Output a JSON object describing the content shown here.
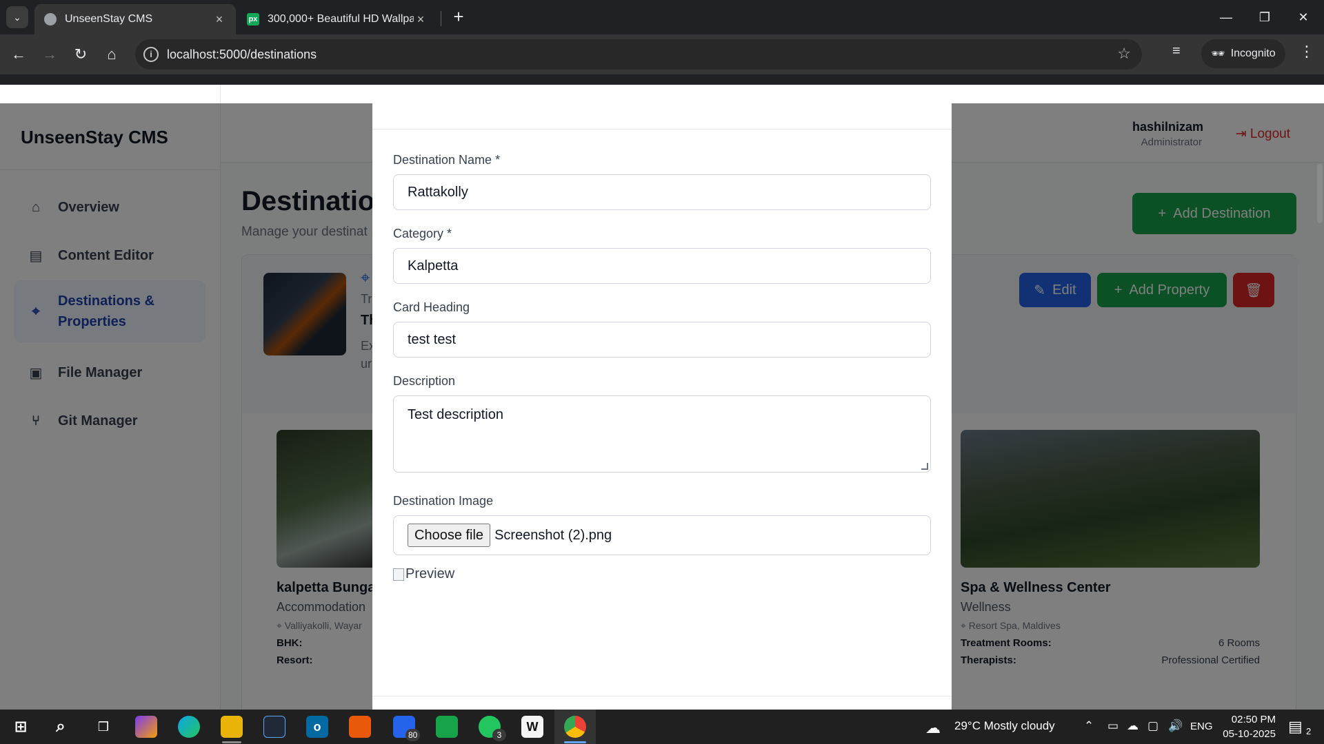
{
  "browser": {
    "tabs": [
      {
        "title": "UnseenStay CMS",
        "active": true
      },
      {
        "title": "300,000+ Beautiful HD Wallpap",
        "active": false
      }
    ],
    "url": "localhost:5000/destinations",
    "incognito_label": "Incognito",
    "favicon_px": "px"
  },
  "app": {
    "brand": "UnseenStay CMS",
    "user_name": "hashilnizam",
    "user_role": "Administrator",
    "logout_label": "Logout",
    "sidebar": [
      {
        "label": "Overview",
        "icon": "home-icon"
      },
      {
        "label": "Content Editor",
        "icon": "document-icon"
      },
      {
        "label": "Destinations &",
        "label2": "Properties",
        "icon": "map-pin-icon",
        "active": true
      },
      {
        "label": "File Manager",
        "icon": "image-icon"
      },
      {
        "label": "Git Manager",
        "icon": "git-branch-icon"
      }
    ],
    "page_title": "Destination",
    "page_subtitle": "Manage your destinat",
    "add_destination_label": "Add Destination",
    "destination_row": {
      "trunc_category": "Tro",
      "trunc_heading": "Th",
      "trunc_desc_1": "Ex",
      "trunc_desc_2": "ur",
      "edit_label": "Edit",
      "add_property_label": "Add Property"
    },
    "properties": [
      {
        "title": "kalpetta Bunga",
        "category": "Accommodation",
        "location": "Valliyakolli, Wayar",
        "rows": [
          {
            "k": "BHK:",
            "v": ""
          },
          {
            "k": "Resort:",
            "v": ""
          }
        ]
      },
      {
        "title": "Spa & Wellness Center",
        "category": "Wellness",
        "location": "Resort Spa, Maldives",
        "rows": [
          {
            "k": "Treatment Rooms:",
            "v": "6 Rooms"
          },
          {
            "k": "Therapists:",
            "v": "Professional Certified"
          }
        ]
      }
    ]
  },
  "modal": {
    "fields": {
      "name_label": "Destination Name *",
      "name_value": "Rattakolly",
      "category_label": "Category *",
      "category_value": "Kalpetta",
      "heading_label": "Card Heading",
      "heading_value": "test test",
      "description_label": "Description",
      "description_value": "Test description",
      "image_label": "Destination Image",
      "choose_file_label": "Choose file",
      "file_name": "Screenshot (2).png",
      "preview_alt": "Preview"
    }
  },
  "taskbar": {
    "weather": "29°C  Mostly cloudy",
    "weather_badge": "3",
    "lang": "ENG",
    "time": "02:50 PM",
    "date": "05-10-2025",
    "notification_count": "2",
    "badges": {
      "mail": "80",
      "whatsapp": "3"
    }
  },
  "colors": {
    "primary_blue": "#2563eb",
    "success_green": "#16a34a",
    "danger_red": "#dc2626"
  }
}
